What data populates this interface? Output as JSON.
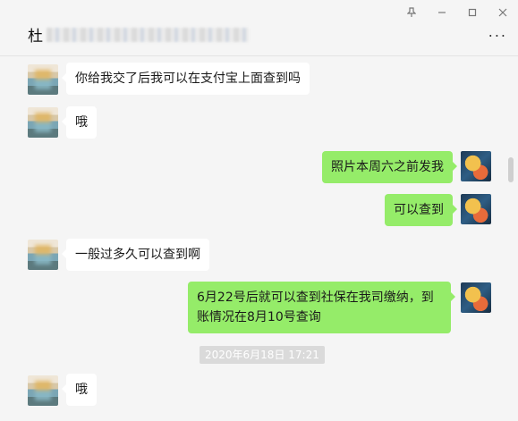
{
  "window": {
    "pin_icon": "pin-icon",
    "minimize_icon": "minimize-icon",
    "maximize_icon": "maximize-icon",
    "close_icon": "close-icon"
  },
  "header": {
    "title": "杜",
    "more": "..."
  },
  "messages": [
    {
      "side": "left",
      "text": "你给我交了后我可以在支付宝上面查到吗"
    },
    {
      "side": "left",
      "text": "哦"
    },
    {
      "side": "right",
      "text": "照片本周六之前发我"
    },
    {
      "side": "right",
      "text": "可以查到"
    },
    {
      "side": "left",
      "text": "一般过多久可以查到啊"
    },
    {
      "side": "right",
      "text": "6月22号后就可以查到社保在我司缴纳，到账情况在8月10号查询"
    },
    {
      "side": "left",
      "text": "哦"
    }
  ],
  "timestamp": "2020年6月18日 17:21"
}
